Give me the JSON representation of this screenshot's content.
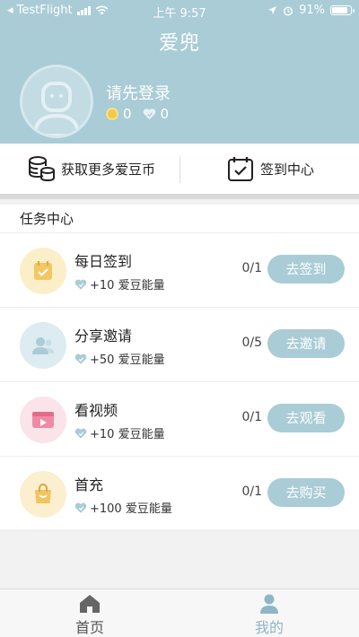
{
  "status_bar": {
    "carrier": "◂ TestFlight",
    "time": "上午 9:57",
    "battery": "91%",
    "battery_level": 0.91
  },
  "header": {
    "title": "爱兜",
    "login_prompt": "请先登录",
    "coins": "0",
    "energy": "0"
  },
  "quick_actions": {
    "get_coins": "获取更多爱豆币",
    "checkin_center": "签到中心"
  },
  "tasks": {
    "title": "任务中心",
    "items": [
      {
        "name": "每日签到",
        "reward": "+10 爱豆能量",
        "progress": "0/1",
        "action": "去签到",
        "icon": "calendar-icon",
        "color": "#f3c763"
      },
      {
        "name": "分享邀请",
        "reward": "+50 爱豆能量",
        "progress": "0/5",
        "action": "去邀请",
        "icon": "users-icon",
        "color": "#a9ccd6"
      },
      {
        "name": "看视频",
        "reward": "+10 爱豆能量",
        "progress": "0/1",
        "action": "去观看",
        "icon": "video-icon",
        "color": "#f08aa4"
      },
      {
        "name": "首充",
        "reward": "+100 爱豆能量",
        "progress": "0/1",
        "action": "去购买",
        "icon": "shopping-bag-icon",
        "color": "#f2c45e"
      }
    ]
  },
  "tabbar": {
    "home": "首页",
    "mine": "我的"
  },
  "colors": {
    "accent": "#a9ccd6",
    "active_tab": "#8fb6c4"
  }
}
